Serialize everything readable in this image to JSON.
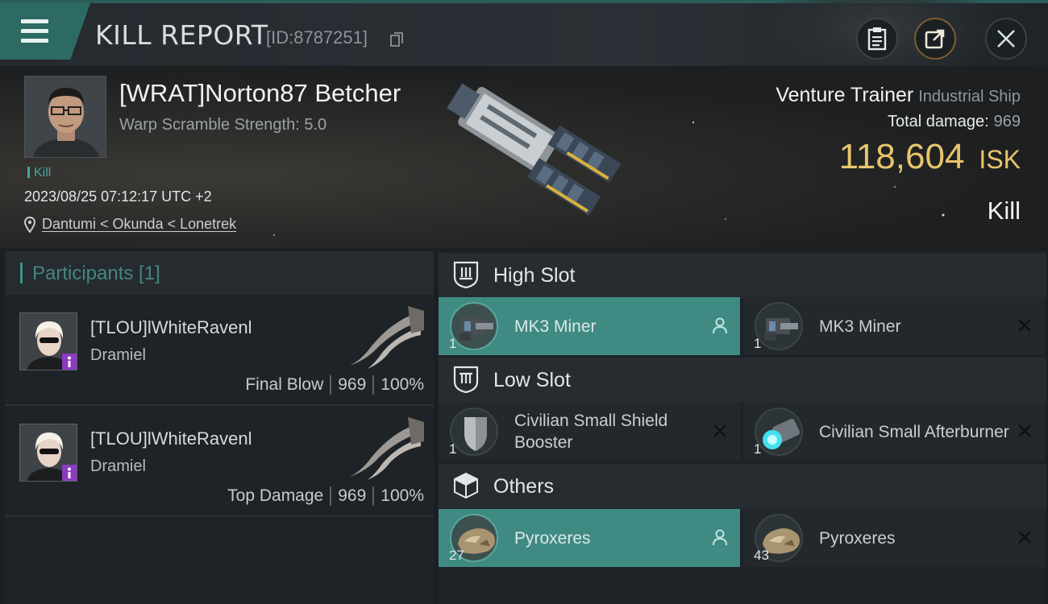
{
  "window": {
    "title": "KILL REPORT",
    "report_id": "[ID:8787251]"
  },
  "victim": {
    "name": "[WRAT]Norton87 Betcher",
    "warp_scramble": "Warp Scramble Strength: 5.0",
    "tag": "Kill",
    "datetime": "2023/08/25 07:12:17 UTC +2",
    "location": "Dantumi < Okunda < Lonetrek"
  },
  "ship": {
    "name": "Venture Trainer",
    "class": "Industrial Ship",
    "total_damage_label": "Total damage:",
    "total_damage": "969",
    "isk_value": "118,604",
    "isk_unit": "ISK",
    "result": "Kill"
  },
  "participants": {
    "label": "Participants [1]",
    "rows": [
      {
        "name": "[TLOU]lWhiteRavenl",
        "corp": "Dramiel",
        "role": "Final Blow",
        "damage": "969",
        "percent": "100%"
      },
      {
        "name": "[TLOU]lWhiteRavenl",
        "corp": "Dramiel",
        "role": "Top Damage",
        "damage": "969",
        "percent": "100%"
      }
    ]
  },
  "slots": {
    "high": {
      "label": "High Slot",
      "items": [
        {
          "name": "MK3 Miner",
          "qty": "1",
          "state": "dropped"
        },
        {
          "name": "MK3 Miner",
          "qty": "1",
          "state": "destroyed"
        }
      ]
    },
    "low": {
      "label": "Low Slot",
      "items": [
        {
          "name": "Civilian Small Shield Booster",
          "qty": "1",
          "state": "destroyed"
        },
        {
          "name": "Civilian Small Afterburner",
          "qty": "1",
          "state": "destroyed"
        }
      ]
    },
    "others": {
      "label": "Others",
      "items": [
        {
          "name": "Pyroxeres",
          "qty": "27",
          "state": "dropped"
        },
        {
          "name": "Pyroxeres",
          "qty": "43",
          "state": "destroyed"
        }
      ]
    }
  },
  "icons": [
    "menu-icon",
    "copy-icon",
    "clipboard-icon",
    "share-icon",
    "close-icon",
    "location-pin-icon",
    "high-slot-icon",
    "low-slot-icon",
    "cargo-box-icon",
    "person-icon",
    "x-icon"
  ],
  "colors": {
    "accent": "#3f8b83",
    "isk": "#e7c56c",
    "badge": "#8d3ac2"
  }
}
